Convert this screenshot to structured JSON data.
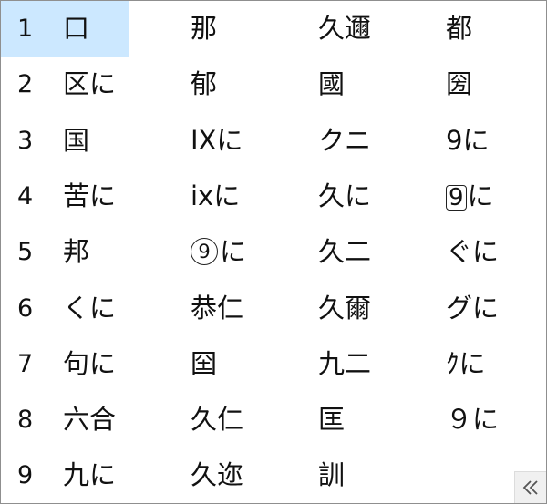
{
  "selected_index": 0,
  "rows": [
    {
      "number": "1",
      "candidates": [
        "口",
        "那",
        "久邇",
        "都"
      ]
    },
    {
      "number": "2",
      "candidates": [
        "区に",
        "郁",
        "國",
        "圀"
      ]
    },
    {
      "number": "3",
      "candidates": [
        "国",
        "IXに",
        "クニ",
        "9に"
      ]
    },
    {
      "number": "4",
      "candidates": [
        "苦に",
        "ixに",
        "久に",
        "9に"
      ]
    },
    {
      "number": "5",
      "candidates": [
        "邦",
        "9に",
        "久二",
        "ぐに"
      ]
    },
    {
      "number": "6",
      "candidates": [
        "くに",
        "恭仁",
        "久爾",
        "グに"
      ]
    },
    {
      "number": "7",
      "candidates": [
        "句に",
        "囶",
        "九二",
        "ｸに"
      ]
    },
    {
      "number": "8",
      "candidates": [
        "六合",
        "久仁",
        "匡",
        "９に"
      ]
    },
    {
      "number": "9",
      "candidates": [
        "九に",
        "久迩",
        "訓"
      ]
    }
  ],
  "decorations": {
    "3-3": "boxed",
    "4-1": "circled"
  },
  "expand_icon": "double-chevron-left-icon",
  "colors": {
    "selection": "#cce8ff",
    "border": "#8f8f8f",
    "text": "#111111"
  }
}
